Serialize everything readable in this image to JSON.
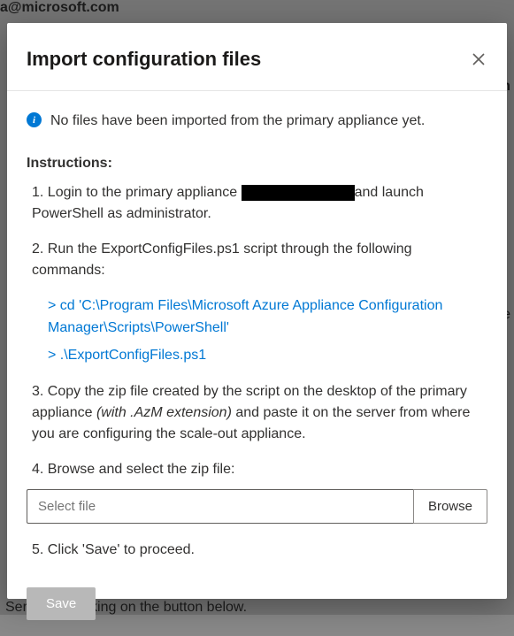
{
  "background": {
    "frag1": "a@microsoft.com",
    "frag2": "om",
    "frag3": "ne",
    "frag4": "Server by clicking on the button below."
  },
  "modal": {
    "title": "Import configuration files",
    "info_message": "No files have been imported from the primary appliance yet.",
    "instructions_heading": "Instructions:",
    "steps": {
      "s1_a": "1. Login to the primary appliance ",
      "s1_b": "and launch PowerShell as administrator.",
      "s2": "2. Run the ExportConfigFiles.ps1 script through the following commands:",
      "code1": "> cd 'C:\\Program Files\\Microsoft Azure Appliance Configuration Manager\\Scripts\\PowerShell'",
      "code2": "> .\\ExportConfigFiles.ps1",
      "s3_a": "3. Copy the zip file created by the script on the desktop of the primary appliance ",
      "s3_italic": "(with .AzM extension)",
      "s3_b": " and paste it on the server from where you are configuring the scale-out appliance.",
      "s4": "4. Browse and select the zip file:",
      "s5": "5. Click 'Save' to proceed."
    },
    "file_placeholder": "Select file",
    "browse_label": "Browse",
    "save_label": "Save"
  }
}
